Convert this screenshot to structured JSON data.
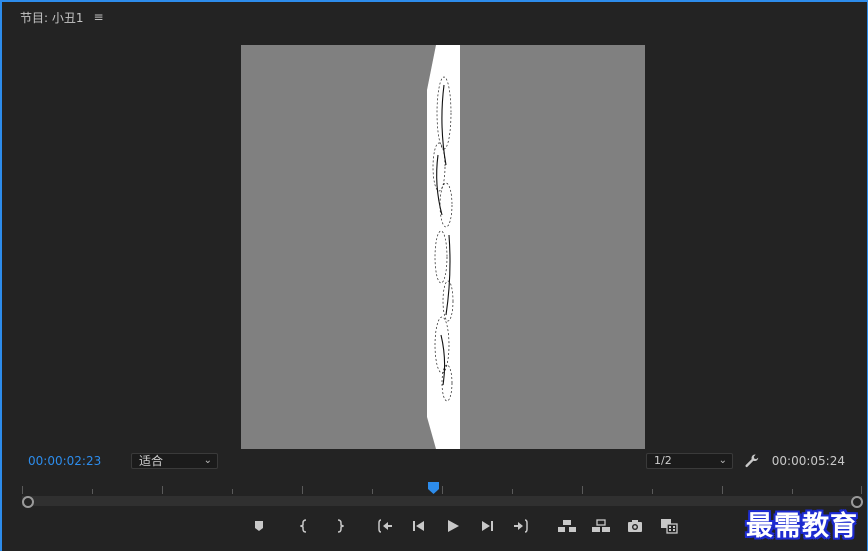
{
  "panel": {
    "title": "节目: 小丑1",
    "menu_icon": "hamburger-menu-icon"
  },
  "timecode": {
    "current": "00:00:02:23",
    "duration": "00:00:05:24"
  },
  "fit_select": {
    "value": "适合"
  },
  "resolution_select": {
    "value": "1/2"
  },
  "playhead_position": 0.49,
  "transport": {
    "icons": [
      "add-marker-icon",
      "mark-in-icon",
      "mark-out-icon",
      "go-to-in-icon",
      "step-back-icon",
      "play-icon",
      "step-forward-icon",
      "go-to-out-icon",
      "lift-icon",
      "extract-icon",
      "export-frame-icon",
      "comparison-view-icon"
    ]
  },
  "watermark": {
    "text": "最需教育"
  },
  "colors": {
    "accent": "#2d8ceb",
    "panel_bg": "#232323",
    "viewer_bg": "#808080"
  }
}
